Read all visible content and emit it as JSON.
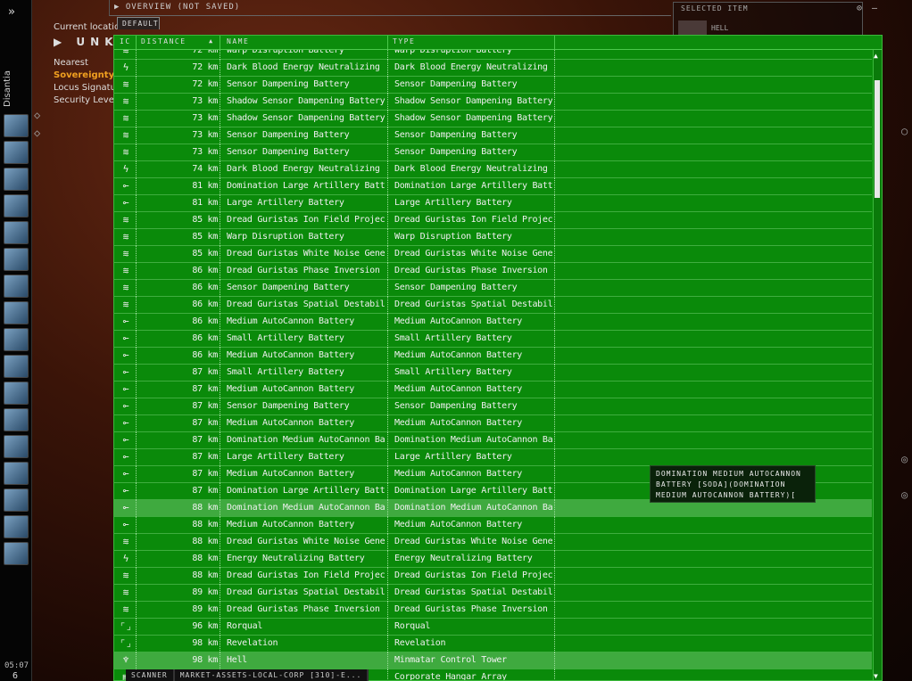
{
  "neocom": {
    "character": "Disantia",
    "expand_icon": "double-chevron-right-icon",
    "clock": "05:07",
    "counter": "6",
    "icons": [
      "character-sheet-icon",
      "assets-icon",
      "mail-icon",
      "map-icon",
      "corporation-icon",
      "market-icon",
      "contracts-icon",
      "starmap-icon",
      "fitting-icon",
      "cargo-icon",
      "scanner-icon",
      "fleet-icon",
      "browser-icon",
      "journal-icon",
      "chat-icon",
      "notepad-icon",
      "help-icon"
    ]
  },
  "location": {
    "label": "Current location",
    "system": "UNKNO",
    "nearest": "Nearest",
    "sovereignty": "Sovereignty",
    "locus": "Locus Signature",
    "security": "Security Level"
  },
  "overview": {
    "title": "OVERVIEW (NOT SAVED)",
    "tab": "DEFAULT",
    "columns": [
      "IC",
      "DISTANCE",
      "NAME",
      "TYPE"
    ],
    "sort_indicator": "ascending",
    "rows": [
      {
        "icon": "ring",
        "dist": "72 km",
        "name": "Warp Disruption Battery",
        "type": "Warp Disruption Battery"
      },
      {
        "icon": "bolt",
        "dist": "72 km",
        "name": "Dark Blood Energy Neutralizing Battery",
        "type": "Dark Blood Energy Neutralizing Battery"
      },
      {
        "icon": "ring",
        "dist": "72 km",
        "name": "Sensor Dampening Battery",
        "type": "Sensor Dampening Battery"
      },
      {
        "icon": "ring",
        "dist": "73 km",
        "name": "Shadow Sensor Dampening Battery",
        "type": "Shadow Sensor Dampening Battery"
      },
      {
        "icon": "ring",
        "dist": "73 km",
        "name": "Shadow Sensor Dampening Battery",
        "type": "Shadow Sensor Dampening Battery"
      },
      {
        "icon": "ring",
        "dist": "73 km",
        "name": "Sensor Dampening Battery",
        "type": "Sensor Dampening Battery"
      },
      {
        "icon": "ring",
        "dist": "73 km",
        "name": "Sensor Dampening Battery",
        "type": "Sensor Dampening Battery"
      },
      {
        "icon": "bolt",
        "dist": "74 km",
        "name": "Dark Blood Energy Neutralizing Battery",
        "type": "Dark Blood Energy Neutralizing Battery"
      },
      {
        "icon": "turret",
        "dist": "81 km",
        "name": "Domination Large Artillery Battery",
        "type": "Domination Large Artillery Battery"
      },
      {
        "icon": "turret",
        "dist": "81 km",
        "name": "Large Artillery Battery",
        "type": "Large Artillery Battery"
      },
      {
        "icon": "ring",
        "dist": "85 km",
        "name": "Dread Guristas Ion Field Projection Batt",
        "type": "Dread Guristas Ion Field Projection Batt"
      },
      {
        "icon": "ring",
        "dist": "85 km",
        "name": "Warp Disruption Battery",
        "type": "Warp Disruption Battery"
      },
      {
        "icon": "ring",
        "dist": "85 km",
        "name": "Dread Guristas White Noise Generation",
        "type": "Dread Guristas White Noise Generation"
      },
      {
        "icon": "ring",
        "dist": "86 km",
        "name": "Dread Guristas Phase Inversion Battery",
        "type": "Dread Guristas Phase Inversion Battery"
      },
      {
        "icon": "ring",
        "dist": "86 km",
        "name": "Sensor Dampening Battery",
        "type": "Sensor Dampening Battery"
      },
      {
        "icon": "ring",
        "dist": "86 km",
        "name": "Dread Guristas Spatial Destabilization B",
        "type": "Dread Guristas Spatial Destabilization B"
      },
      {
        "icon": "turret",
        "dist": "86 km",
        "name": "Medium AutoCannon Battery",
        "type": "Medium AutoCannon Battery"
      },
      {
        "icon": "turret",
        "dist": "86 km",
        "name": "Small Artillery Battery",
        "type": "Small Artillery Battery"
      },
      {
        "icon": "turret",
        "dist": "86 km",
        "name": "Medium AutoCannon Battery",
        "type": "Medium AutoCannon Battery"
      },
      {
        "icon": "turret",
        "dist": "87 km",
        "name": "Small Artillery Battery",
        "type": "Small Artillery Battery"
      },
      {
        "icon": "turret",
        "dist": "87 km",
        "name": "Medium AutoCannon Battery",
        "type": "Medium AutoCannon Battery"
      },
      {
        "icon": "turret",
        "dist": "87 km",
        "name": "Sensor Dampening Battery",
        "type": "Sensor Dampening Battery"
      },
      {
        "icon": "turret",
        "dist": "87 km",
        "name": "Medium AutoCannon Battery",
        "type": "Medium AutoCannon Battery"
      },
      {
        "icon": "turret",
        "dist": "87 km",
        "name": "Domination Medium AutoCannon Battery",
        "type": "Domination Medium AutoCannon Battery"
      },
      {
        "icon": "turret",
        "dist": "87 km",
        "name": "Large Artillery Battery",
        "type": "Large Artillery Battery"
      },
      {
        "icon": "turret",
        "dist": "87 km",
        "name": "Medium AutoCannon Battery",
        "type": "Medium AutoCannon Battery"
      },
      {
        "icon": "turret",
        "dist": "87 km",
        "name": "Domination Large Artillery Battery",
        "type": "Domination Large Artillery Battery"
      },
      {
        "icon": "turret",
        "dist": "88 km",
        "name": "Domination Medium AutoCannon Battery",
        "type": "Domination Medium AutoCannon Battery",
        "highlighted": true
      },
      {
        "icon": "turret",
        "dist": "88 km",
        "name": "Medium AutoCannon Battery",
        "type": "Medium AutoCannon Battery"
      },
      {
        "icon": "ring",
        "dist": "88 km",
        "name": "Dread Guristas White Noise Generation",
        "type": "Dread Guristas White Noise Generation"
      },
      {
        "icon": "bolt",
        "dist": "88 km",
        "name": "Energy Neutralizing Battery",
        "type": "Energy Neutralizing Battery"
      },
      {
        "icon": "ring",
        "dist": "88 km",
        "name": "Dread Guristas Ion Field Projection Batt",
        "type": "Dread Guristas Ion Field Projection Batt"
      },
      {
        "icon": "ring",
        "dist": "89 km",
        "name": "Dread Guristas Spatial Destabilization B",
        "type": "Dread Guristas Spatial Destabilization B"
      },
      {
        "icon": "ring",
        "dist": "89 km",
        "name": "Dread Guristas Phase Inversion Battery",
        "type": "Dread Guristas Phase Inversion Battery"
      },
      {
        "icon": "bracket",
        "dist": "96 km",
        "name": "Rorqual",
        "type": "Rorqual"
      },
      {
        "icon": "bracket",
        "dist": "98 km",
        "name": "Revelation",
        "type": "Revelation"
      },
      {
        "icon": "tower",
        "dist": "98 km",
        "name": "Hell",
        "type": "Minmatar Control Tower",
        "highlighted": true
      },
      {
        "icon": "hangar",
        "dist": "",
        "name": "",
        "type": "Corporate Hangar Array"
      }
    ]
  },
  "tooltip": "DOMINATION MEDIUM AUTOCANNON BATTERY [SODA](DOMINATION MEDIUM AUTOCANNON BATTERY)[",
  "selected_item": {
    "title": "SELECTED ITEM",
    "name": "HELL"
  },
  "bottom_tabs": [
    "SCANNER",
    "MARKET-ASSETS-LOCAL-CORP [310]-E..."
  ],
  "colors": {
    "overview_bg": "#0a8a0a",
    "highlight_row": "#3faa3f",
    "sovereignty": "#f0a020"
  }
}
